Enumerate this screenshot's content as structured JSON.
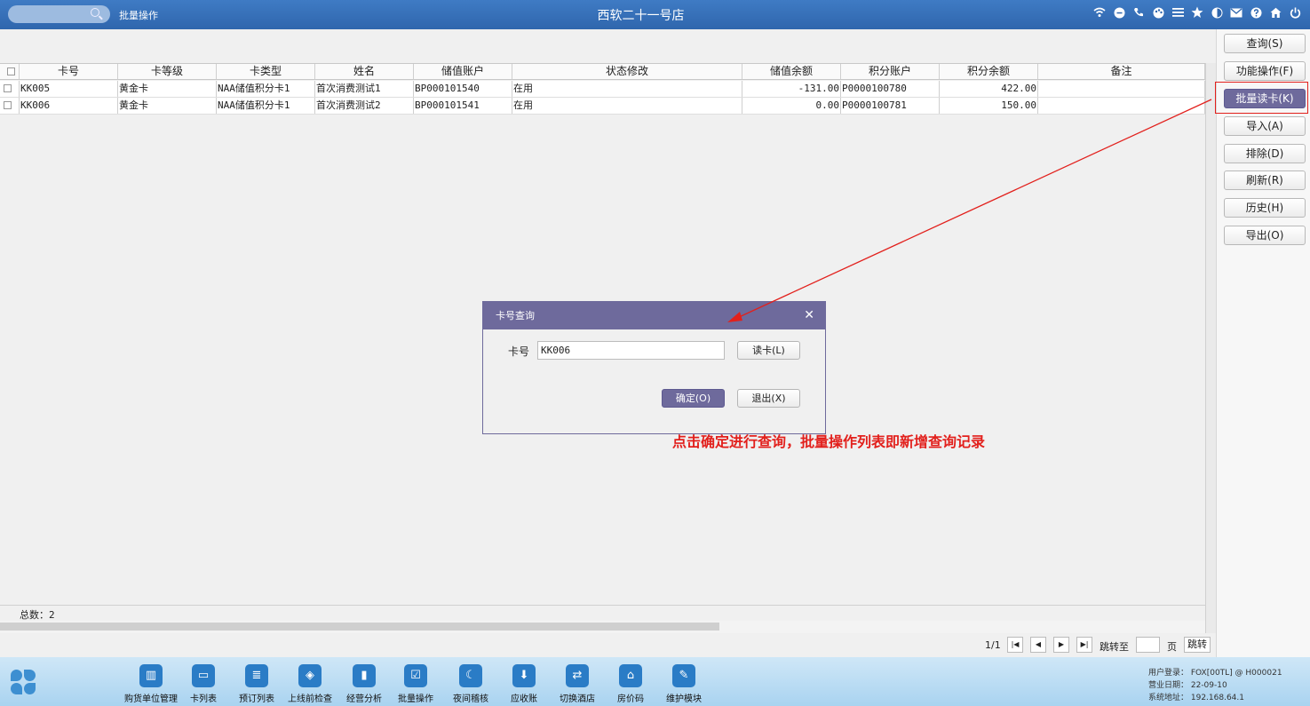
{
  "topbar": {
    "section": "批量操作",
    "title": "西软二十一号店",
    "icons": [
      "wifi-icon",
      "chat-icon",
      "phone-icon",
      "palette-icon",
      "menu-icon",
      "star-icon",
      "theme-icon",
      "mail-icon",
      "help-icon",
      "home-icon",
      "power-icon"
    ]
  },
  "right_buttons": [
    {
      "label": "查询(S)"
    },
    {
      "label": "功能操作(F)"
    },
    {
      "label": "批量读卡(K)"
    },
    {
      "label": "导入(A)"
    },
    {
      "label": "排除(D)"
    },
    {
      "label": "刷新(R)"
    },
    {
      "label": "历史(H)"
    },
    {
      "label": "导出(O)"
    }
  ],
  "table": {
    "columns": [
      "卡号",
      "卡等级",
      "卡类型",
      "姓名",
      "储值账户",
      "状态修改",
      "储值余额",
      "积分账户",
      "积分余额",
      "备注"
    ],
    "rows": [
      [
        "KK005",
        "黄金卡",
        "NAA储值积分卡1",
        "首次消费测试1",
        "BP000101540",
        "在用",
        "-131.00",
        "P0000100780",
        "422.00",
        ""
      ],
      [
        "KK006",
        "黄金卡",
        "NAA储值积分卡1",
        "首次消费测试2",
        "BP000101541",
        "在用",
        "0.00",
        "P0000100781",
        "150.00",
        ""
      ]
    ]
  },
  "summary": "总数：2",
  "pager": {
    "page_info": "1/1",
    "goto_label": "跳转至",
    "page_unit": "页",
    "jump_button": "跳转",
    "page_input": ""
  },
  "dialog": {
    "title": "卡号查询",
    "card_label": "卡号",
    "card_value": "KK006",
    "read_button": "读卡(L)",
    "confirm_button": "确定(O)",
    "exit_button": "退出(X)"
  },
  "annotation": "点击确定进行查询，批量操作列表即新增查询记录",
  "bottombar": {
    "modules": [
      "购货单位管理",
      "卡列表",
      "预订列表",
      "上线前检查",
      "经营分析",
      "批量操作",
      "夜间稽核",
      "应收账",
      "切换酒店",
      "房价码",
      "维护模块"
    ],
    "sysinfo": {
      "user": "用户登录：  FOX[00TL] @ H000021",
      "date": "营业日期：  22-09-10",
      "addr": "系统地址：  192.168.64.1"
    }
  },
  "colors": {
    "topbar": "#2f66ad",
    "accent": "#6e6a9c",
    "annotation": "#e2201c",
    "bottombar": "#a9d3f0"
  }
}
